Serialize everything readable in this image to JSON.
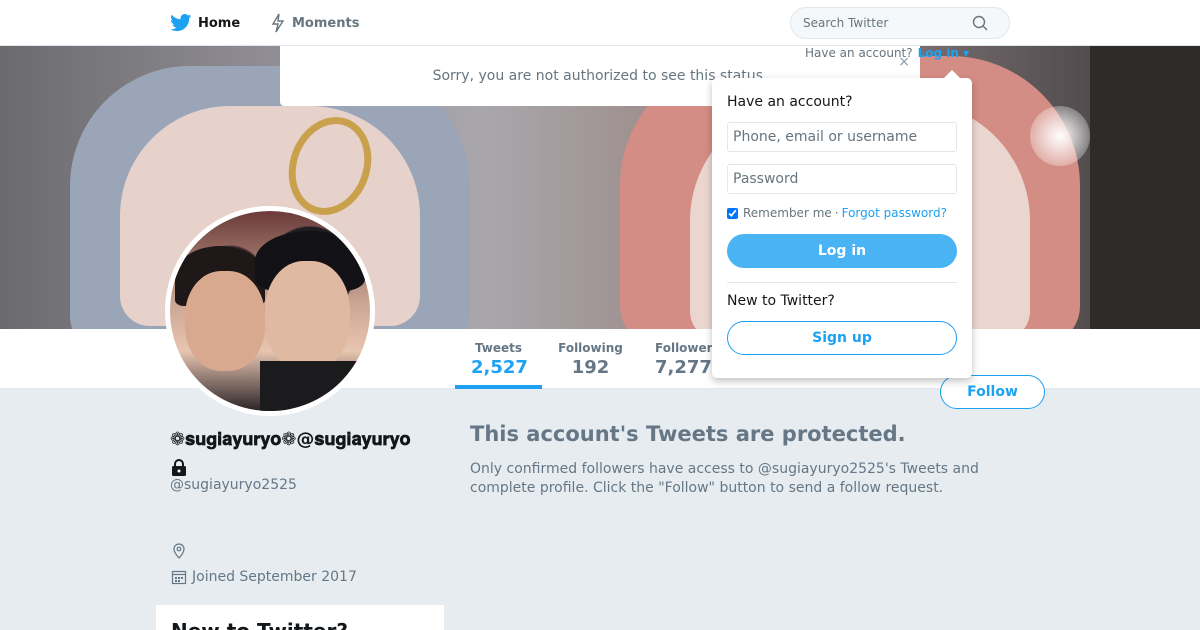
{
  "nav": {
    "home_label": "Home",
    "moments_label": "Moments",
    "search_placeholder": "Search Twitter"
  },
  "alert": {
    "message": "Sorry, you are not authorized to see this status.",
    "close_glyph": "×"
  },
  "login_trigger": {
    "question": "Have an account?",
    "link": "Log in",
    "caret": "▾"
  },
  "login": {
    "heading": "Have an account?",
    "username_placeholder": "Phone, email or username",
    "password_placeholder": "Password",
    "remember_label": "Remember me",
    "separator": "·",
    "forgot_label": "Forgot password?",
    "login_button": "Log in",
    "new_heading": "New to Twitter?",
    "signup_button": "Sign up"
  },
  "stats": {
    "tweets_label": "Tweets",
    "tweets_value": "2,527",
    "following_label": "Following",
    "following_value": "192",
    "followers_label": "Followers",
    "followers_value": "7,277"
  },
  "follow_button": "Follow",
  "profile": {
    "name": "❁𝐬𝐮𝐠𝐢𝐚𝐲𝐮𝐫𝐲𝐨❁@𝐬𝐮𝐠𝐢𝐚𝐲𝐮𝐫𝐲𝐨",
    "handle": "@sugiayuryo2525",
    "joined": "Joined September 2017"
  },
  "new_card_title": "New to Twitter?",
  "protected": {
    "heading": "This account's Tweets are protected.",
    "body": "Only confirmed followers have access to @sugiayuryo2525's Tweets and complete profile. Click the \"Follow\" button to send a follow request."
  },
  "colors": {
    "brand": "#1da1f2",
    "background": "#e6ecf0",
    "muted_text": "#657786"
  },
  "icons": [
    "twitter-bird-icon",
    "moments-bolt-icon",
    "search-icon",
    "lock-icon",
    "location-icon",
    "calendar-icon",
    "close-icon"
  ]
}
